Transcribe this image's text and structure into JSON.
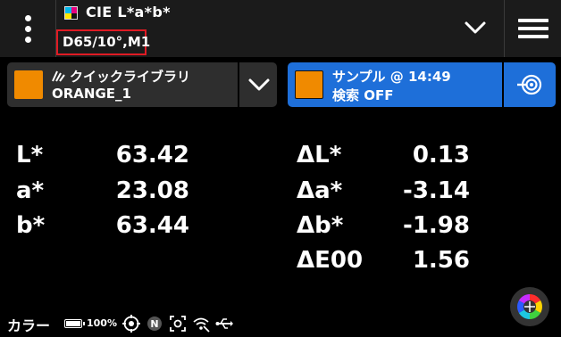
{
  "header": {
    "title": "CIE L*a*b*",
    "illuminant": "D65/10°,M1",
    "title_icon": "cmyk-square-icon",
    "menu_icon": "more-vertical-icon",
    "dropdown_icon": "chevron-down-icon",
    "hamburger_icon": "hamburger-menu-icon"
  },
  "standard": {
    "library_label": "クイックライブラリ",
    "library_icon": "library-icon",
    "name": "ORANGE_1",
    "swatch_color": "#f08a00"
  },
  "sample": {
    "line1": "サンプル @ 14:49",
    "line2": "検索 OFF",
    "swatch_color": "#f08a00",
    "accent_color": "#1e6fd9",
    "target_icon": "target-measure-icon"
  },
  "values": [
    {
      "label": "L*",
      "value": "63.42"
    },
    {
      "label": "a*",
      "value": "23.08"
    },
    {
      "label": "b*",
      "value": "63.44"
    }
  ],
  "deltas": [
    {
      "label": "ΔL*",
      "value": "0.13"
    },
    {
      "label": "Δa*",
      "value": "-3.14"
    },
    {
      "label": "Δb*",
      "value": "-1.98"
    },
    {
      "label": "ΔE00",
      "value": "1.56"
    }
  ],
  "status": {
    "mode_label": "カラー",
    "battery": "100%",
    "icons": [
      "target-icon",
      "n-badge-icon",
      "camera-focus-icon",
      "wifi-off-icon",
      "usb-icon"
    ],
    "color_wheel_icon": "color-wheel-icon"
  }
}
